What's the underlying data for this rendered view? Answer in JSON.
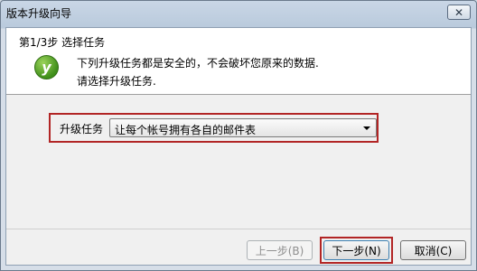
{
  "window": {
    "title": "版本升级向导",
    "close_glyph": "✕"
  },
  "header": {
    "step_title": "第1/3步 选择任务",
    "icon_glyph": "y",
    "description_line1": "下列升级任务都是安全的，不会破坏您原来的数据.",
    "description_line2": "请选择升级任务."
  },
  "task": {
    "label": "升级任务",
    "selected": "让每个帐号拥有各自的邮件表"
  },
  "buttons": {
    "prev": "上一步(B)",
    "next": "下一步(N)",
    "cancel": "取消(C)"
  },
  "colors": {
    "highlight": "#b22525",
    "icon_green": "#3f8f1a"
  }
}
